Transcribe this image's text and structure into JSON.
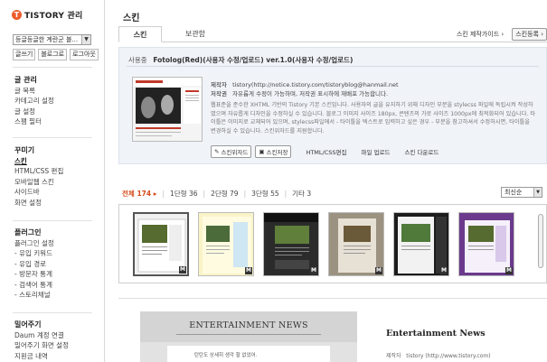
{
  "brand": {
    "logo_mark": "T",
    "name": "TISTORY",
    "suffix": "관리"
  },
  "blog_select": {
    "value": "등글등글한 계란군 블..."
  },
  "side_links": [
    "글쓰기",
    "블로그로",
    "로그아웃"
  ],
  "sidebar": {
    "groups": [
      {
        "heading": "글 관리",
        "items": [
          "글 목록",
          "카테고리 설정",
          "글 설정",
          "스팸 필터"
        ]
      },
      {
        "heading": "꾸미기",
        "items": [
          "스킨",
          "HTML/CSS 편집",
          "모바일웹 스킨",
          "사이드바",
          "화면 설정"
        ],
        "active": "스킨"
      },
      {
        "heading": "플러그인",
        "items": [
          "플러그인 설정",
          "- 유입 키워드",
          "- 유입 경로",
          "- 방문자 통계",
          "- 검색어 통계",
          "- 스토리채널"
        ]
      },
      {
        "heading": "밀어주기",
        "items": [
          "Daum 계정 연결",
          "밀어주기 화면 설정",
          "지원금 내역"
        ]
      }
    ]
  },
  "page": {
    "title": "스킨"
  },
  "tabs": [
    {
      "label": "스킨",
      "active": true
    },
    {
      "label": "보관함",
      "active": false
    }
  ],
  "tab_links": {
    "maker_guide": "스킨 제작가이드 ›",
    "register": "스킨등록 ›"
  },
  "skin_info": {
    "category": "사용중",
    "name": "Fotolog(Red)(사용자 수정/업로드) ver.1.0(사용자 수정/업로드)",
    "maker_label": "제작자",
    "maker": "tistory(http://notice.tistory.com/tistoryblog@hanmail.net",
    "license_label": "저작권",
    "license": "자유롭게 수정이 가능하며, 저작권 표시하에 재배포 가능합니다.",
    "description": "웹표준을 준수한 XHTML 기반의 Tistory 기본 스킨입니다. 사용자의 글을 유지하기 위해 디자인 부분을 stylecss 파일에 독립시켜 작성하였으며 자유롭게 디자인을 수정하실 수 있습니다. 블로그 이미지 사이즈 180px, 콘텐츠의 가로 사이즈 1000px에 최적화되어 있습니다. 타이틀은 이미지로 교체되어 있으며, stylecss파일에서 - 타이틀을 텍스트로 입력하고 싶은 경우 - 부분을 참고하셔서 수정하시면, 타이틀을 변경하실 수 있습니다. 스킨위자드를 지원합니다.",
    "actions": {
      "wizard": "스킨위자드",
      "save": "스킨저장",
      "edit": "HTML/CSS편집",
      "upload": "파일 업로드",
      "download": "스킨 다운로드"
    }
  },
  "filters": [
    {
      "label": "전체",
      "count": "174",
      "active": true
    },
    {
      "label": "1단형",
      "count": "36"
    },
    {
      "label": "2단형",
      "count": "79"
    },
    {
      "label": "3단형",
      "count": "55"
    },
    {
      "label": "기타",
      "count": "3"
    }
  ],
  "sort": {
    "value": "최신순"
  },
  "thumbs": [
    {
      "badge": "M"
    },
    {
      "badge": "M"
    },
    {
      "badge": "M"
    },
    {
      "badge": "M"
    },
    {
      "badge": "M"
    },
    {
      "badge": "M"
    }
  ],
  "preview": {
    "left_title": "ENTERTAINMENT NEWS",
    "left_card_text": "탄탄도 상세히 생각 할 없었어.",
    "right_title": "Entertainment News",
    "right_meta_label": "제작자",
    "right_meta_value": "tistory (http://www.tistory.com)"
  },
  "colors": {
    "accent": "#d34a1a",
    "brand": "#ec5b2b",
    "panel": "#f0f3f8"
  }
}
